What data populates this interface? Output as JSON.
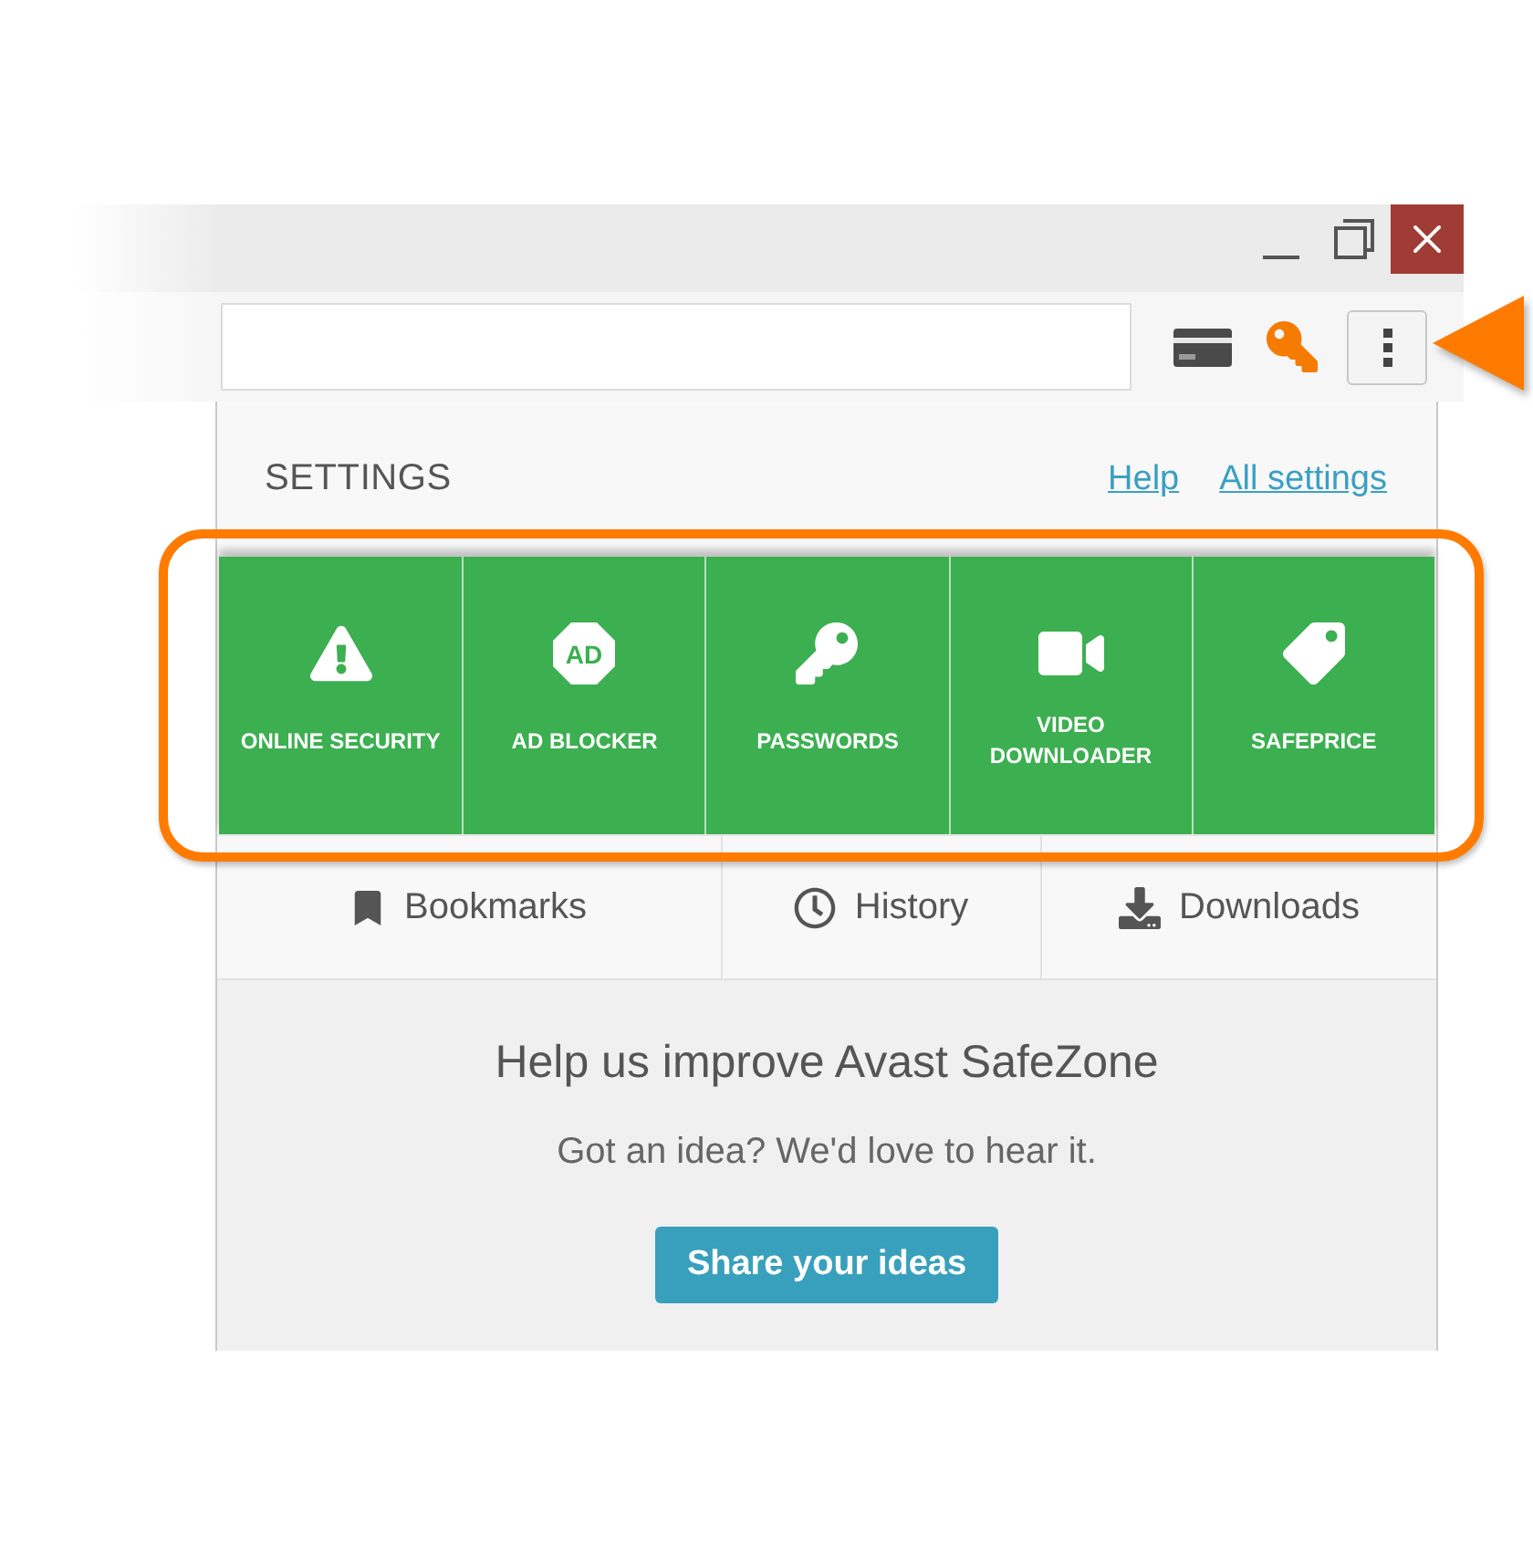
{
  "toolbar": {
    "menu_button": {
      "highlighted": true
    }
  },
  "settings_panel": {
    "title": "SETTINGS",
    "links": [
      "Help",
      "All settings"
    ],
    "feature_tiles": {
      "highlighted": true,
      "items": [
        {
          "kind": "security",
          "label": "ONLINE SECURITY"
        },
        {
          "kind": "adblock",
          "label": "AD BLOCKER",
          "badge": "AD"
        },
        {
          "kind": "passwords",
          "label": "PASSWORDS"
        },
        {
          "kind": "video",
          "label": "VIDEO DOWNLOADER"
        },
        {
          "kind": "price",
          "label": "SAFEPRICE"
        }
      ]
    },
    "nav": [
      {
        "kind": "bookmarks",
        "label": "Bookmarks"
      },
      {
        "kind": "history",
        "label": "History"
      },
      {
        "kind": "downloads",
        "label": "Downloads"
      }
    ],
    "feedback": {
      "heading": "Help us improve Avast SafeZone",
      "text": "Got an idea? We'd love to hear it.",
      "button": "Share your ideas"
    }
  }
}
